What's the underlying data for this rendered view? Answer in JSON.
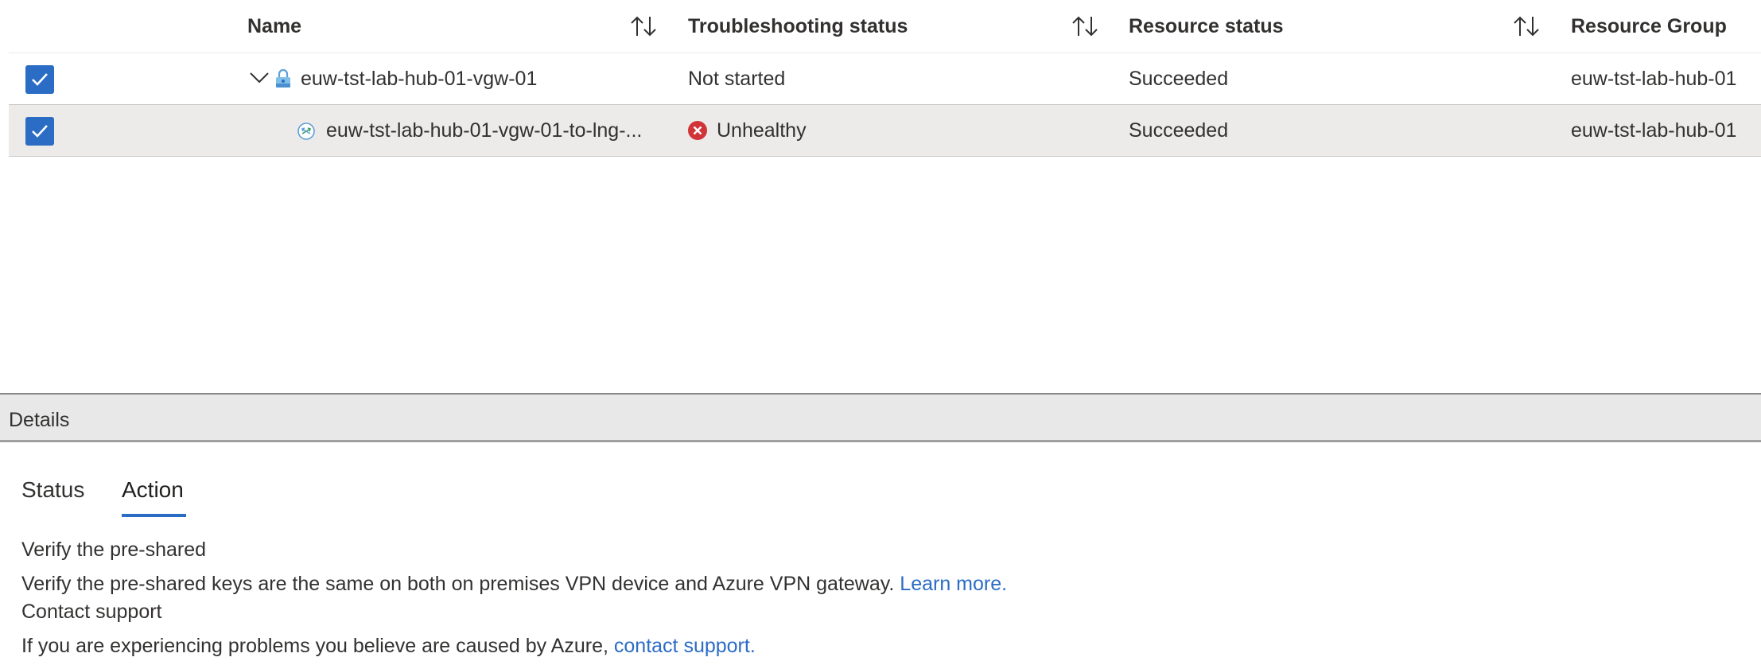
{
  "grid": {
    "columns": [
      {
        "label": "Name"
      },
      {
        "label": "Troubleshooting status"
      },
      {
        "label": "Resource status"
      },
      {
        "label": "Resource Group"
      }
    ],
    "rows": [
      {
        "name": "euw-tst-lab-hub-01-vgw-01",
        "troubleshooting_status": "Not started",
        "resource_status": "Succeeded",
        "resource_group": "euw-tst-lab-hub-01"
      },
      {
        "name": "euw-tst-lab-hub-01-vgw-01-to-lng-...",
        "troubleshooting_status": "Unhealthy",
        "resource_status": "Succeeded",
        "resource_group": "euw-tst-lab-hub-01"
      }
    ]
  },
  "details": {
    "title": "Details",
    "tabs": [
      {
        "label": "Status"
      },
      {
        "label": "Action"
      }
    ],
    "active_tab": "Action",
    "action": {
      "heading_1": "Verify the pre-shared",
      "text_1": "Verify the pre-shared keys are the same on both on premises VPN device and Azure VPN gateway.",
      "link_1": "Learn more.",
      "heading_2": "Contact support",
      "text_2": "If you are experiencing problems you believe are caused by Azure,",
      "link_2": "contact support."
    }
  },
  "colors": {
    "accent": "#2b6cc4",
    "error": "#d13438",
    "selected_row": "#edebe9",
    "details_bar": "#e8e8e8"
  },
  "icons": {
    "sort": "sort-arrows-icon",
    "expand": "chevron-down-icon",
    "gateway": "vpn-gateway-icon",
    "connection": "connection-icon",
    "error": "error-circle-icon",
    "check": "checkmark-icon"
  }
}
